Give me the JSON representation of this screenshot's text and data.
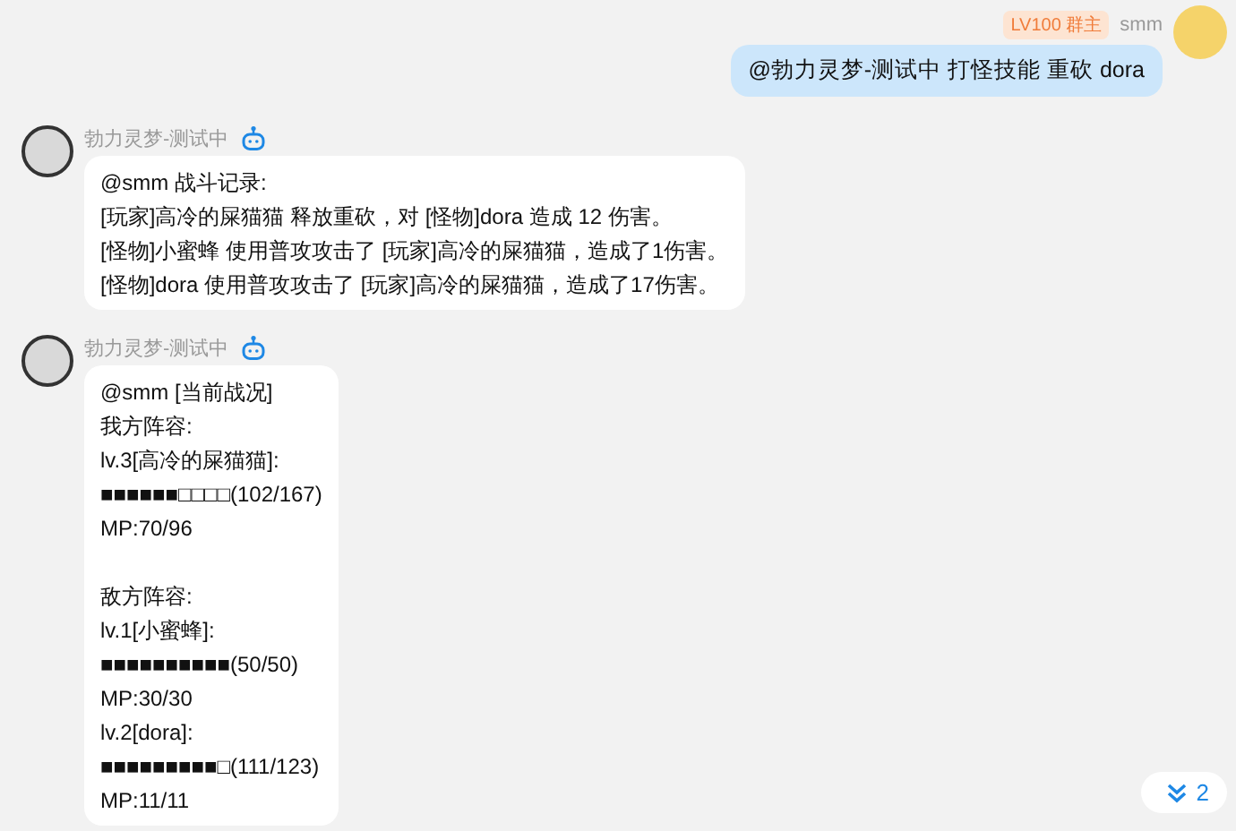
{
  "messages": [
    {
      "kind": "outgoing",
      "sender": "smm",
      "badge": "LV100 群主",
      "paragraphs": [
        [
          "@勃力灵梦-测试中 打怪技能 重砍 dora"
        ]
      ]
    },
    {
      "kind": "incoming",
      "sender": "勃力灵梦-测试中",
      "bot": true,
      "paragraphs": [
        [
          "@smm 战斗记录:",
          "[玩家]高冷的屎猫猫 释放重砍，对 [怪物]dora 造成 12 伤害。",
          "[怪物]小蜜蜂 使用普攻攻击了 [玩家]高冷的屎猫猫，造成了1伤害。",
          "[怪物]dora 使用普攻攻击了 [玩家]高冷的屎猫猫，造成了17伤害。"
        ]
      ]
    },
    {
      "kind": "incoming",
      "sender": "勃力灵梦-测试中",
      "bot": true,
      "paragraphs": [
        [
          "@smm [当前战况]",
          "我方阵容:",
          "lv.3[高冷的屎猫猫]:",
          "■■■■■■□□□□(102/167)",
          "MP:70/96"
        ],
        [
          "敌方阵容:",
          "lv.1[小蜜蜂]:",
          "■■■■■■■■■■(50/50)",
          "MP:30/30",
          "lv.2[dora]:",
          "■■■■■■■■■□(111/123)",
          "MP:11/11"
        ]
      ]
    }
  ],
  "unread": {
    "count": "2"
  }
}
